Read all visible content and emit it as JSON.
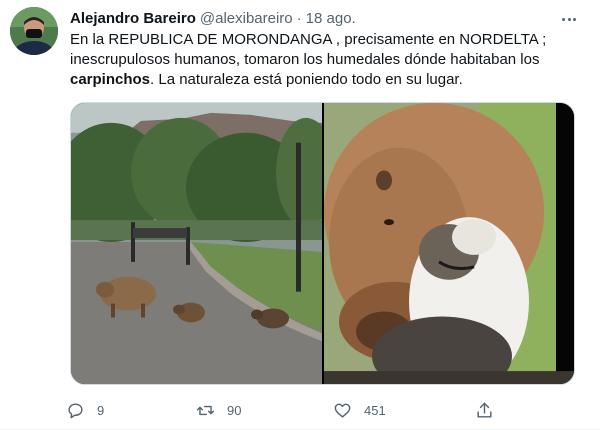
{
  "tweet": {
    "display_name": "Alejandro Bareiro",
    "handle": "@alexibareiro",
    "separator": "·",
    "timestamp": "18 ago.",
    "text_line1": "En la REPUBLICA DE MORONDANGA , precisamente en NORDELTA ;",
    "text_line2": "inescrupulosos humanos, tomaron los humedales dónde habitaban los",
    "text_bold": "carpinchos",
    "text_line3_rest": ". La naturaleza está poniendo todo en su lugar."
  },
  "actions": {
    "replies": "9",
    "retweets": "90",
    "likes": "451"
  },
  "icons": {
    "reply": "reply-icon",
    "retweet": "retweet-icon",
    "like": "heart-icon",
    "share": "share-icon",
    "more": "more-icon"
  },
  "colors": {
    "text": "#0f1419",
    "secondary": "#536471",
    "border": "#cfd9de"
  }
}
